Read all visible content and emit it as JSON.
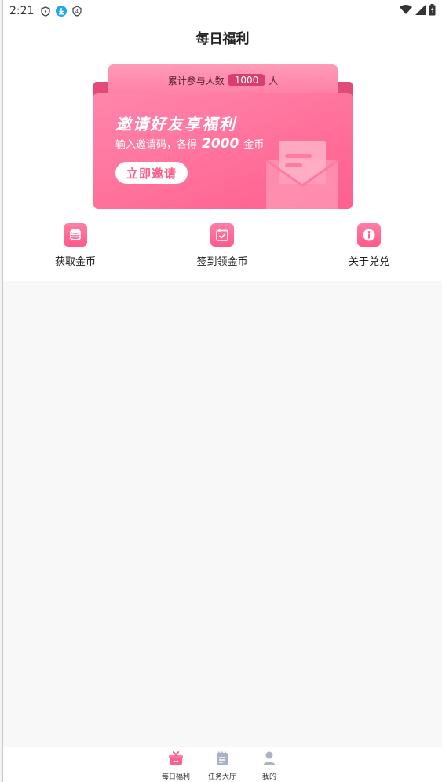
{
  "statusbar": {
    "time": "2:21",
    "icons": [
      "shield-icon",
      "download-icon",
      "badge-4-icon",
      "wifi-icon",
      "signal-icon",
      "battery-icon"
    ],
    "badge_text": "4"
  },
  "header": {
    "title": "每日福利"
  },
  "banner": {
    "participants_label": "累计参与人数",
    "participants_count": "1000",
    "participants_unit": "人",
    "headline": "邀请好友享福利",
    "subline_prefix": "输入邀请码，各得",
    "subline_amount": "2000",
    "subline_suffix": "金币",
    "invite_button": "立即邀请",
    "colors": {
      "primary": "#ff5f8c",
      "light": "#ff86ac",
      "dark": "#d83e6e"
    }
  },
  "features": [
    {
      "label": "获取金币",
      "icon": "coins-icon"
    },
    {
      "label": "签到领金币",
      "icon": "calendar-check-icon"
    },
    {
      "label": "关于兑兑",
      "icon": "info-icon"
    }
  ],
  "tabbar": {
    "items": [
      {
        "label": "每日福利",
        "icon": "gift-icon",
        "active": true
      },
      {
        "label": "任务大厅",
        "icon": "notepad-icon",
        "active": false
      },
      {
        "label": "我的",
        "icon": "user-icon",
        "active": false
      }
    ]
  }
}
